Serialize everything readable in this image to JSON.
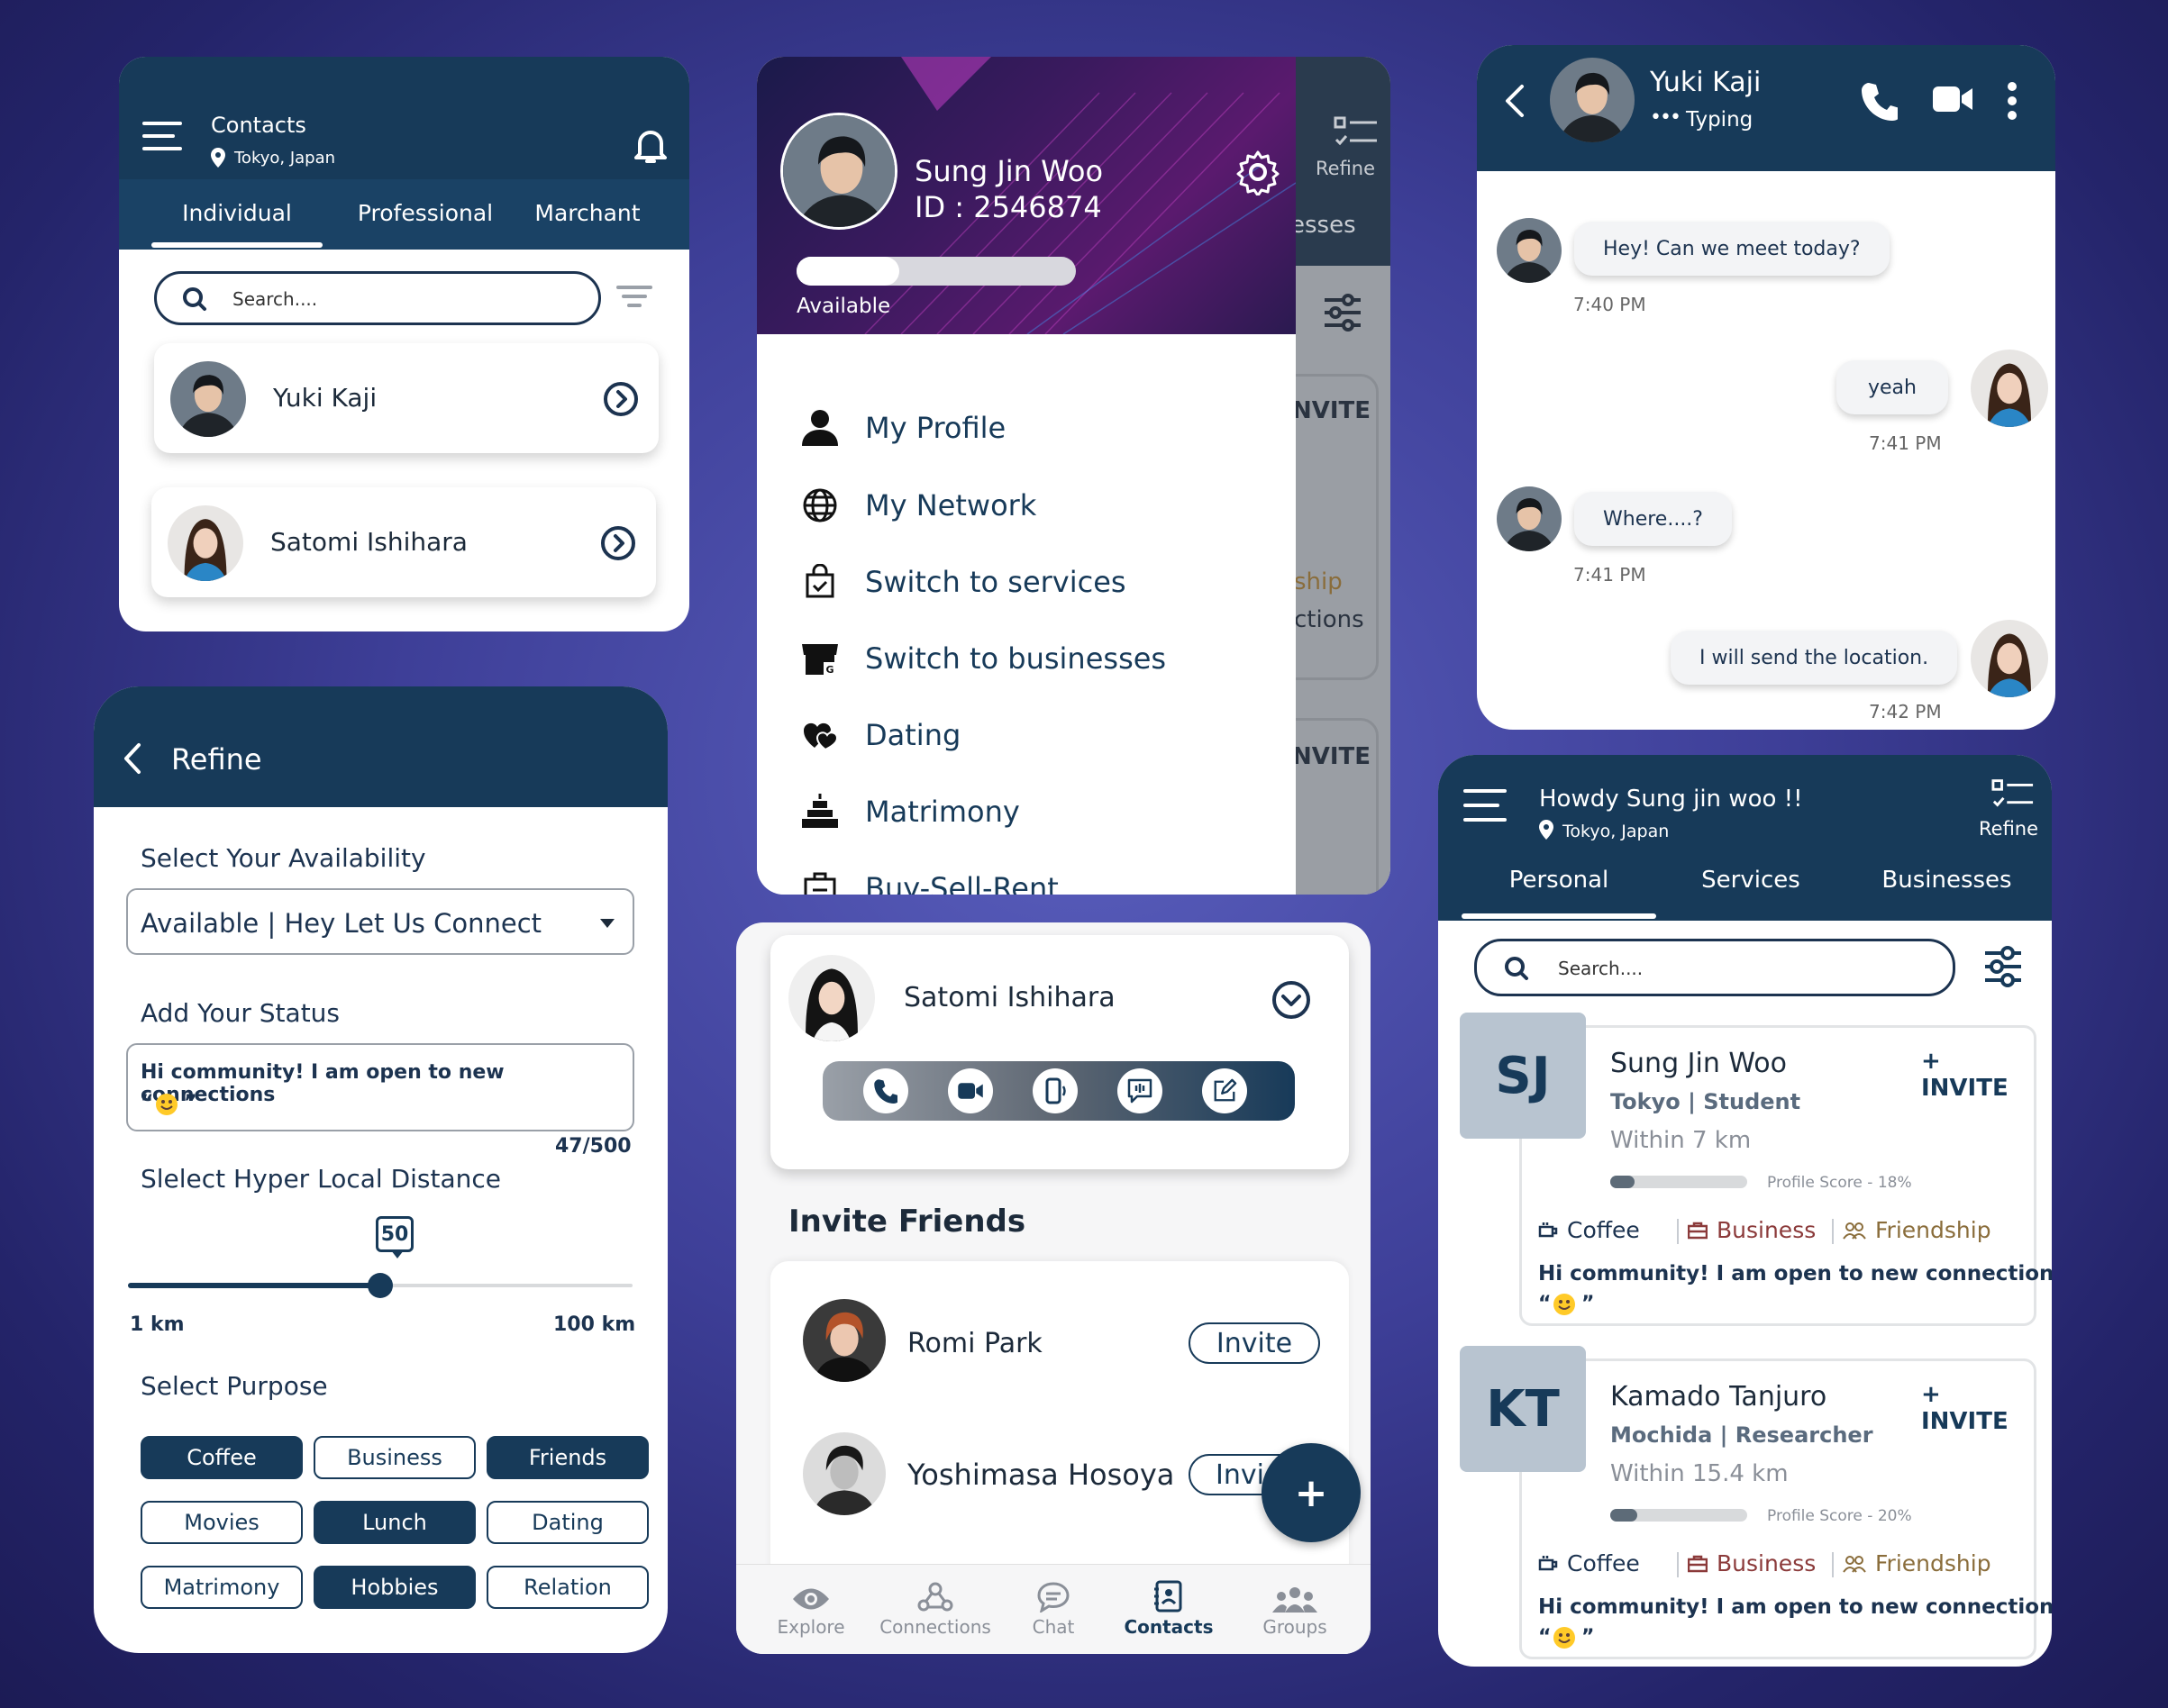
{
  "contacts_card": {
    "title": "Contacts",
    "location": "Tokyo, Japan",
    "tabs": [
      "Individual",
      "Professional",
      "Marchant"
    ],
    "search_placeholder": "Search....",
    "people": [
      "Yuki Kaji",
      "Satomi Ishihara"
    ]
  },
  "menu_card": {
    "name": "Sung Jin Woo",
    "id": "ID : 2546874",
    "status": "Available",
    "refine_label": "Refine",
    "bg_fragments": [
      "esses",
      "NVITE",
      "ship",
      "ctions",
      "NVITE"
    ],
    "items": [
      "My Profile",
      "My Network",
      "Switch to services",
      "Switch to businesses",
      "Dating",
      "Matrimony",
      "Buy-Sell-Rent"
    ]
  },
  "chat_card": {
    "name": "Yuki Kaji",
    "status": "Typing",
    "messages": [
      {
        "text": "Hey! Can we meet today?",
        "time": "7:40 PM"
      },
      {
        "text": "yeah",
        "time": "7:41 PM"
      },
      {
        "text": "Where....?",
        "time": "7:41 PM"
      },
      {
        "text": "I will send the location.",
        "time": "7:42 PM"
      }
    ]
  },
  "refine_card": {
    "title": "Refine",
    "availability_label": "Select Your Availability",
    "availability_value": "Available | Hey Let Us Connect",
    "status_label": "Add Your Status",
    "status_text": "Hi community! I am open to new connections",
    "status_quote_open": "“",
    "status_quote_close": "”",
    "char_count": "47/500",
    "distance_label": "Slelect Hyper Local Distance",
    "distance_value": "50",
    "distance_min": "1 km",
    "distance_max": "100 km",
    "distance_level_fraction": 0.5,
    "purpose_label": "Select Purpose",
    "purposes": [
      {
        "label": "Coffee",
        "on": true
      },
      {
        "label": "Business",
        "on": false
      },
      {
        "label": "Friends",
        "on": true
      },
      {
        "label": "Movies",
        "on": false
      },
      {
        "label": "Lunch",
        "on": true
      },
      {
        "label": "Dating",
        "on": false
      },
      {
        "label": "Matrimony",
        "on": false
      },
      {
        "label": "Hobbies",
        "on": true
      },
      {
        "label": "Relation",
        "on": false
      }
    ]
  },
  "invite_card": {
    "expanded_name": "Satomi Ishihara",
    "section_title": "Invite Friends",
    "friends": [
      {
        "name": "Romi Park",
        "button": "Invite"
      },
      {
        "name": "Yoshimasa Hosoya",
        "button": "Invi"
      }
    ],
    "fab": "+",
    "nav": [
      "Explore",
      "Connections",
      "Chat",
      "Contacts",
      "Groups"
    ]
  },
  "personal_card": {
    "greeting": "Howdy Sung jin woo !!",
    "location": "Tokyo, Japan",
    "refine_label": "Refine",
    "tabs": [
      "Personal",
      "Services",
      "Businesses"
    ],
    "search_placeholder": "Search....",
    "people": [
      {
        "initials": "SJ",
        "name": "Sung Jin Woo",
        "invite": "+ INVITE",
        "meta": "Tokyo | Student",
        "distance": "Within 7 km",
        "score": "Profile Score - 18%",
        "score_fraction": 0.18,
        "tags": [
          "Coffee",
          "Business",
          "Friendship"
        ],
        "bio": "Hi community! I am open to new connections"
      },
      {
        "initials": "KT",
        "name": "Kamado Tanjuro",
        "invite": "+ INVITE",
        "meta": "Mochida | Researcher",
        "distance": "Within 15.4 km",
        "score": "Profile Score - 20%",
        "score_fraction": 0.2,
        "tags": [
          "Coffee",
          "Business",
          "Friendship"
        ],
        "bio": "Hi community! I am open to new connections"
      }
    ],
    "quote_open": "“",
    "quote_close": "”"
  },
  "colors": {
    "navy": "#173a59",
    "accent_brown": "#8a6d3b",
    "accent_red": "#8b3a3a"
  }
}
